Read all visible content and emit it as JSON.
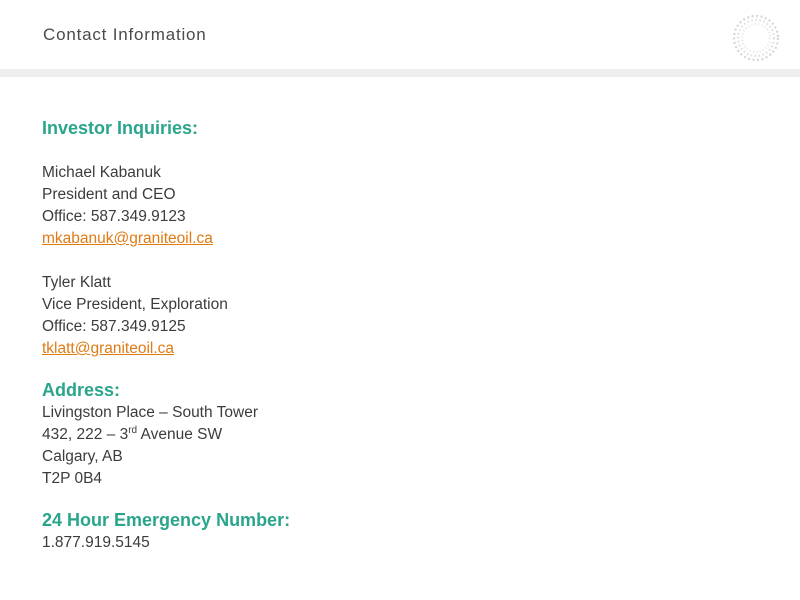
{
  "header": {
    "title": "Contact Information"
  },
  "investor": {
    "heading": "Investor Inquiries:",
    "contacts": [
      {
        "name": "Michael Kabanuk",
        "title": "President and CEO",
        "office": "Office: 587.349.9123",
        "email": "mkabanuk@graniteoil.ca"
      },
      {
        "name": "Tyler Klatt",
        "title": "Vice President, Exploration",
        "office": "Office: 587.349.9125",
        "email": "tklatt@graniteoil.ca"
      }
    ]
  },
  "address": {
    "heading": "Address:",
    "line1": "Livingston Place – South Tower",
    "line2_prefix": "432, 222 – 3",
    "line2_sup": "rd",
    "line2_suffix": " Avenue SW",
    "line3": "Calgary, AB",
    "line4": "T2P 0B4"
  },
  "emergency": {
    "heading": "24 Hour Emergency Number:",
    "number": "1.877.919.5145"
  },
  "colors": {
    "heading": "#2aa58c",
    "link": "#e07b14",
    "text": "#3c3c3c",
    "header_bar": "#eeeeee"
  },
  "icons": {
    "logo": "dotted-ring-logo"
  }
}
